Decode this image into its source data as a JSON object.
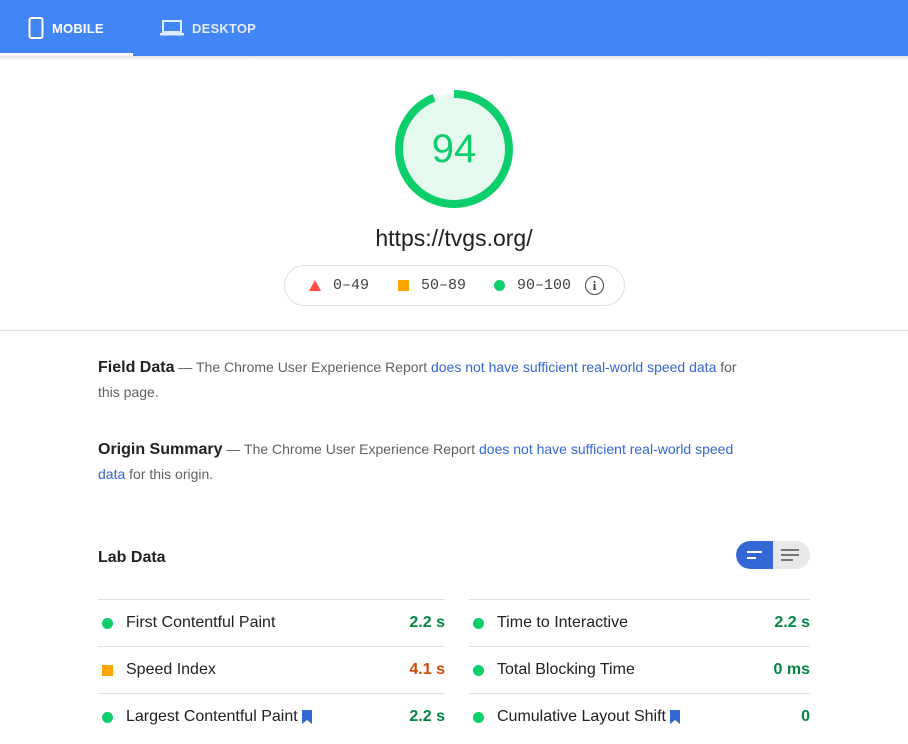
{
  "tabs": [
    {
      "label": "MOBILE",
      "icon": "mobile-phone-icon",
      "active": true
    },
    {
      "label": "DESKTOP",
      "icon": "laptop-icon",
      "active": false
    }
  ],
  "score": {
    "value": "94",
    "progress": 0.94,
    "color": "#0cce6b",
    "bg": "#e6f9ef"
  },
  "url": "https://tvgs.org/",
  "legend": {
    "fail": "0–49",
    "average": "50–89",
    "pass": "90–100",
    "info_glyph": "i"
  },
  "field_data": {
    "title": "Field Data",
    "prefix": " — The Chrome User Experience Report ",
    "link": "does not have sufficient real-world speed data",
    "suffix": " for this page."
  },
  "origin_summary": {
    "title": "Origin Summary",
    "prefix": " — The Chrome User Experience Report ",
    "link": "does not have sufficient real-world speed data",
    "suffix": " for this origin."
  },
  "lab_data": {
    "title": "Lab Data",
    "metrics_left": [
      {
        "name": "First Contentful Paint",
        "value": "2.2 s",
        "status": "green",
        "bookmark": false
      },
      {
        "name": "Speed Index",
        "value": "4.1 s",
        "status": "orange",
        "bookmark": false
      },
      {
        "name": "Largest Contentful Paint",
        "value": "2.2 s",
        "status": "green",
        "bookmark": true
      }
    ],
    "metrics_right": [
      {
        "name": "Time to Interactive",
        "value": "2.2 s",
        "status": "green",
        "bookmark": false
      },
      {
        "name": "Total Blocking Time",
        "value": "0 ms",
        "status": "green",
        "bookmark": false
      },
      {
        "name": "Cumulative Layout Shift",
        "value": "0",
        "status": "green",
        "bookmark": true
      }
    ]
  },
  "colors": {
    "tabbar": "#4285f4",
    "pass": "#0cce6b",
    "average": "#ffa400",
    "fail": "#ff4e42",
    "link": "#3367d6",
    "toggle_active": "#3367d6"
  }
}
